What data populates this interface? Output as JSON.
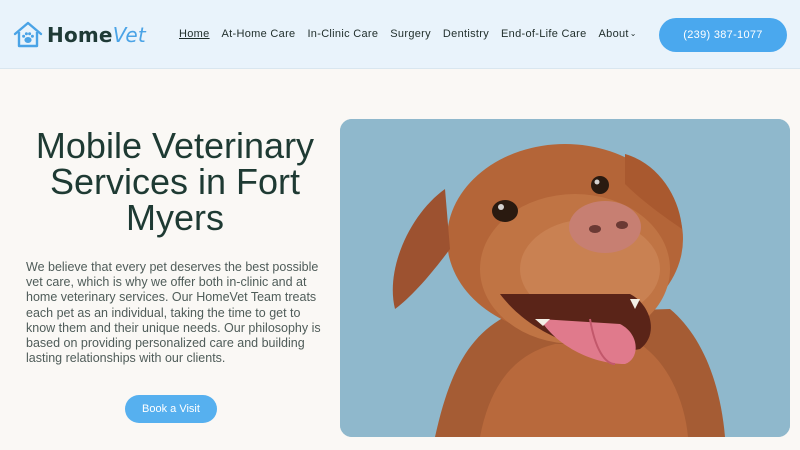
{
  "brand": {
    "name_part1": "Home",
    "name_part2": "Vet"
  },
  "nav": {
    "items": [
      {
        "label": "Home",
        "active": true
      },
      {
        "label": "At-Home Care"
      },
      {
        "label": "In-Clinic Care"
      },
      {
        "label": "Surgery"
      },
      {
        "label": "Dentistry"
      },
      {
        "label": "End-of-Life Care"
      },
      {
        "label": "About"
      }
    ]
  },
  "header": {
    "phone": "(239) 387-1077"
  },
  "hero": {
    "title": "Mobile Veterinary Services in Fort Myers",
    "description": "We believe that every pet deserves the best possible vet care, which is why we offer both in-clinic and at home veterinary services. Our HomeVet Team treats each pet as an individual, taking the time to get to know them and their unique needs. Our philosophy is based on providing personalized care and building lasting relationships with our clients.",
    "cta": "Book a Visit"
  },
  "colors": {
    "header_bg": "#e9f3fb",
    "page_bg": "#faf8f5",
    "accent": "#4aa8ee",
    "title": "#1e3a33",
    "image_bg": "#8fb8cc"
  },
  "icons": {
    "logo": "house-paw-icon",
    "about_dropdown": "chevron-down-icon"
  }
}
